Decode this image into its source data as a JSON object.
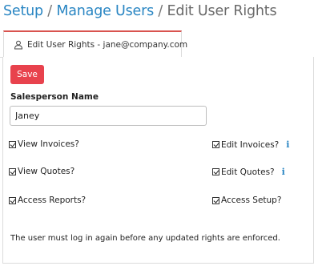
{
  "breadcrumb": {
    "setup": "Setup",
    "sep1": " / ",
    "manage_users": "Manage Users",
    "sep2": " / ",
    "current": "Edit User Rights"
  },
  "tab": {
    "icon": "user-icon",
    "label": "Edit User Rights - jane@company.com"
  },
  "form": {
    "save_label": "Save",
    "salesperson_label": "Salesperson Name",
    "salesperson_value": "Janey",
    "rights": [
      {
        "label": "View Invoices?",
        "checked": true,
        "info": false
      },
      {
        "label": "Edit Invoices?",
        "checked": true,
        "info": true
      },
      {
        "label": "View Quotes?",
        "checked": true,
        "info": false
      },
      {
        "label": "Edit Quotes?",
        "checked": true,
        "info": true
      },
      {
        "label": "Access Reports?",
        "checked": true,
        "info": false
      },
      {
        "label": "Access Setup?",
        "checked": true,
        "info": false
      }
    ],
    "info_glyph": "i",
    "note": "The user must log in again before any updated rights are enforced."
  },
  "colors": {
    "link": "#2a86c3",
    "save_button": "#e8424d",
    "tab_accent": "#d9534f"
  }
}
